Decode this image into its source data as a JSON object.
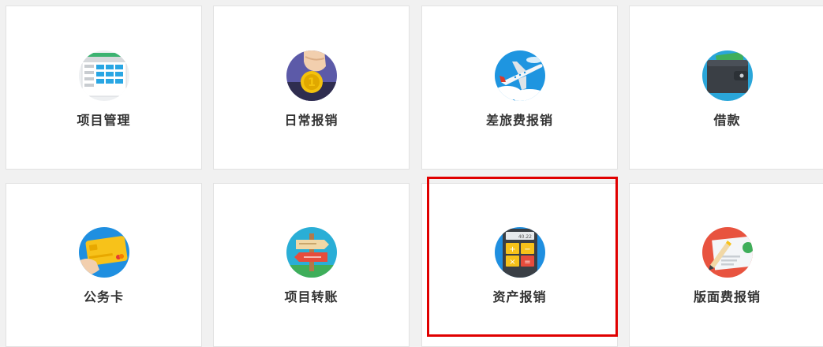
{
  "tiles": [
    {
      "label": "项目管理",
      "icon": "spreadsheet-icon"
    },
    {
      "label": "日常报销",
      "icon": "coin-hand-icon"
    },
    {
      "label": "差旅费报销",
      "icon": "airplane-icon"
    },
    {
      "label": "借款",
      "icon": "wallet-icon"
    },
    {
      "label": "公务卡",
      "icon": "credit-card-icon"
    },
    {
      "label": "项目转账",
      "icon": "signpost-icon"
    },
    {
      "label": "资产报销",
      "icon": "calculator-icon"
    },
    {
      "label": "版面费报销",
      "icon": "document-pen-icon"
    }
  ],
  "calculator_display": "40.22",
  "highlight_color": "#e00000"
}
